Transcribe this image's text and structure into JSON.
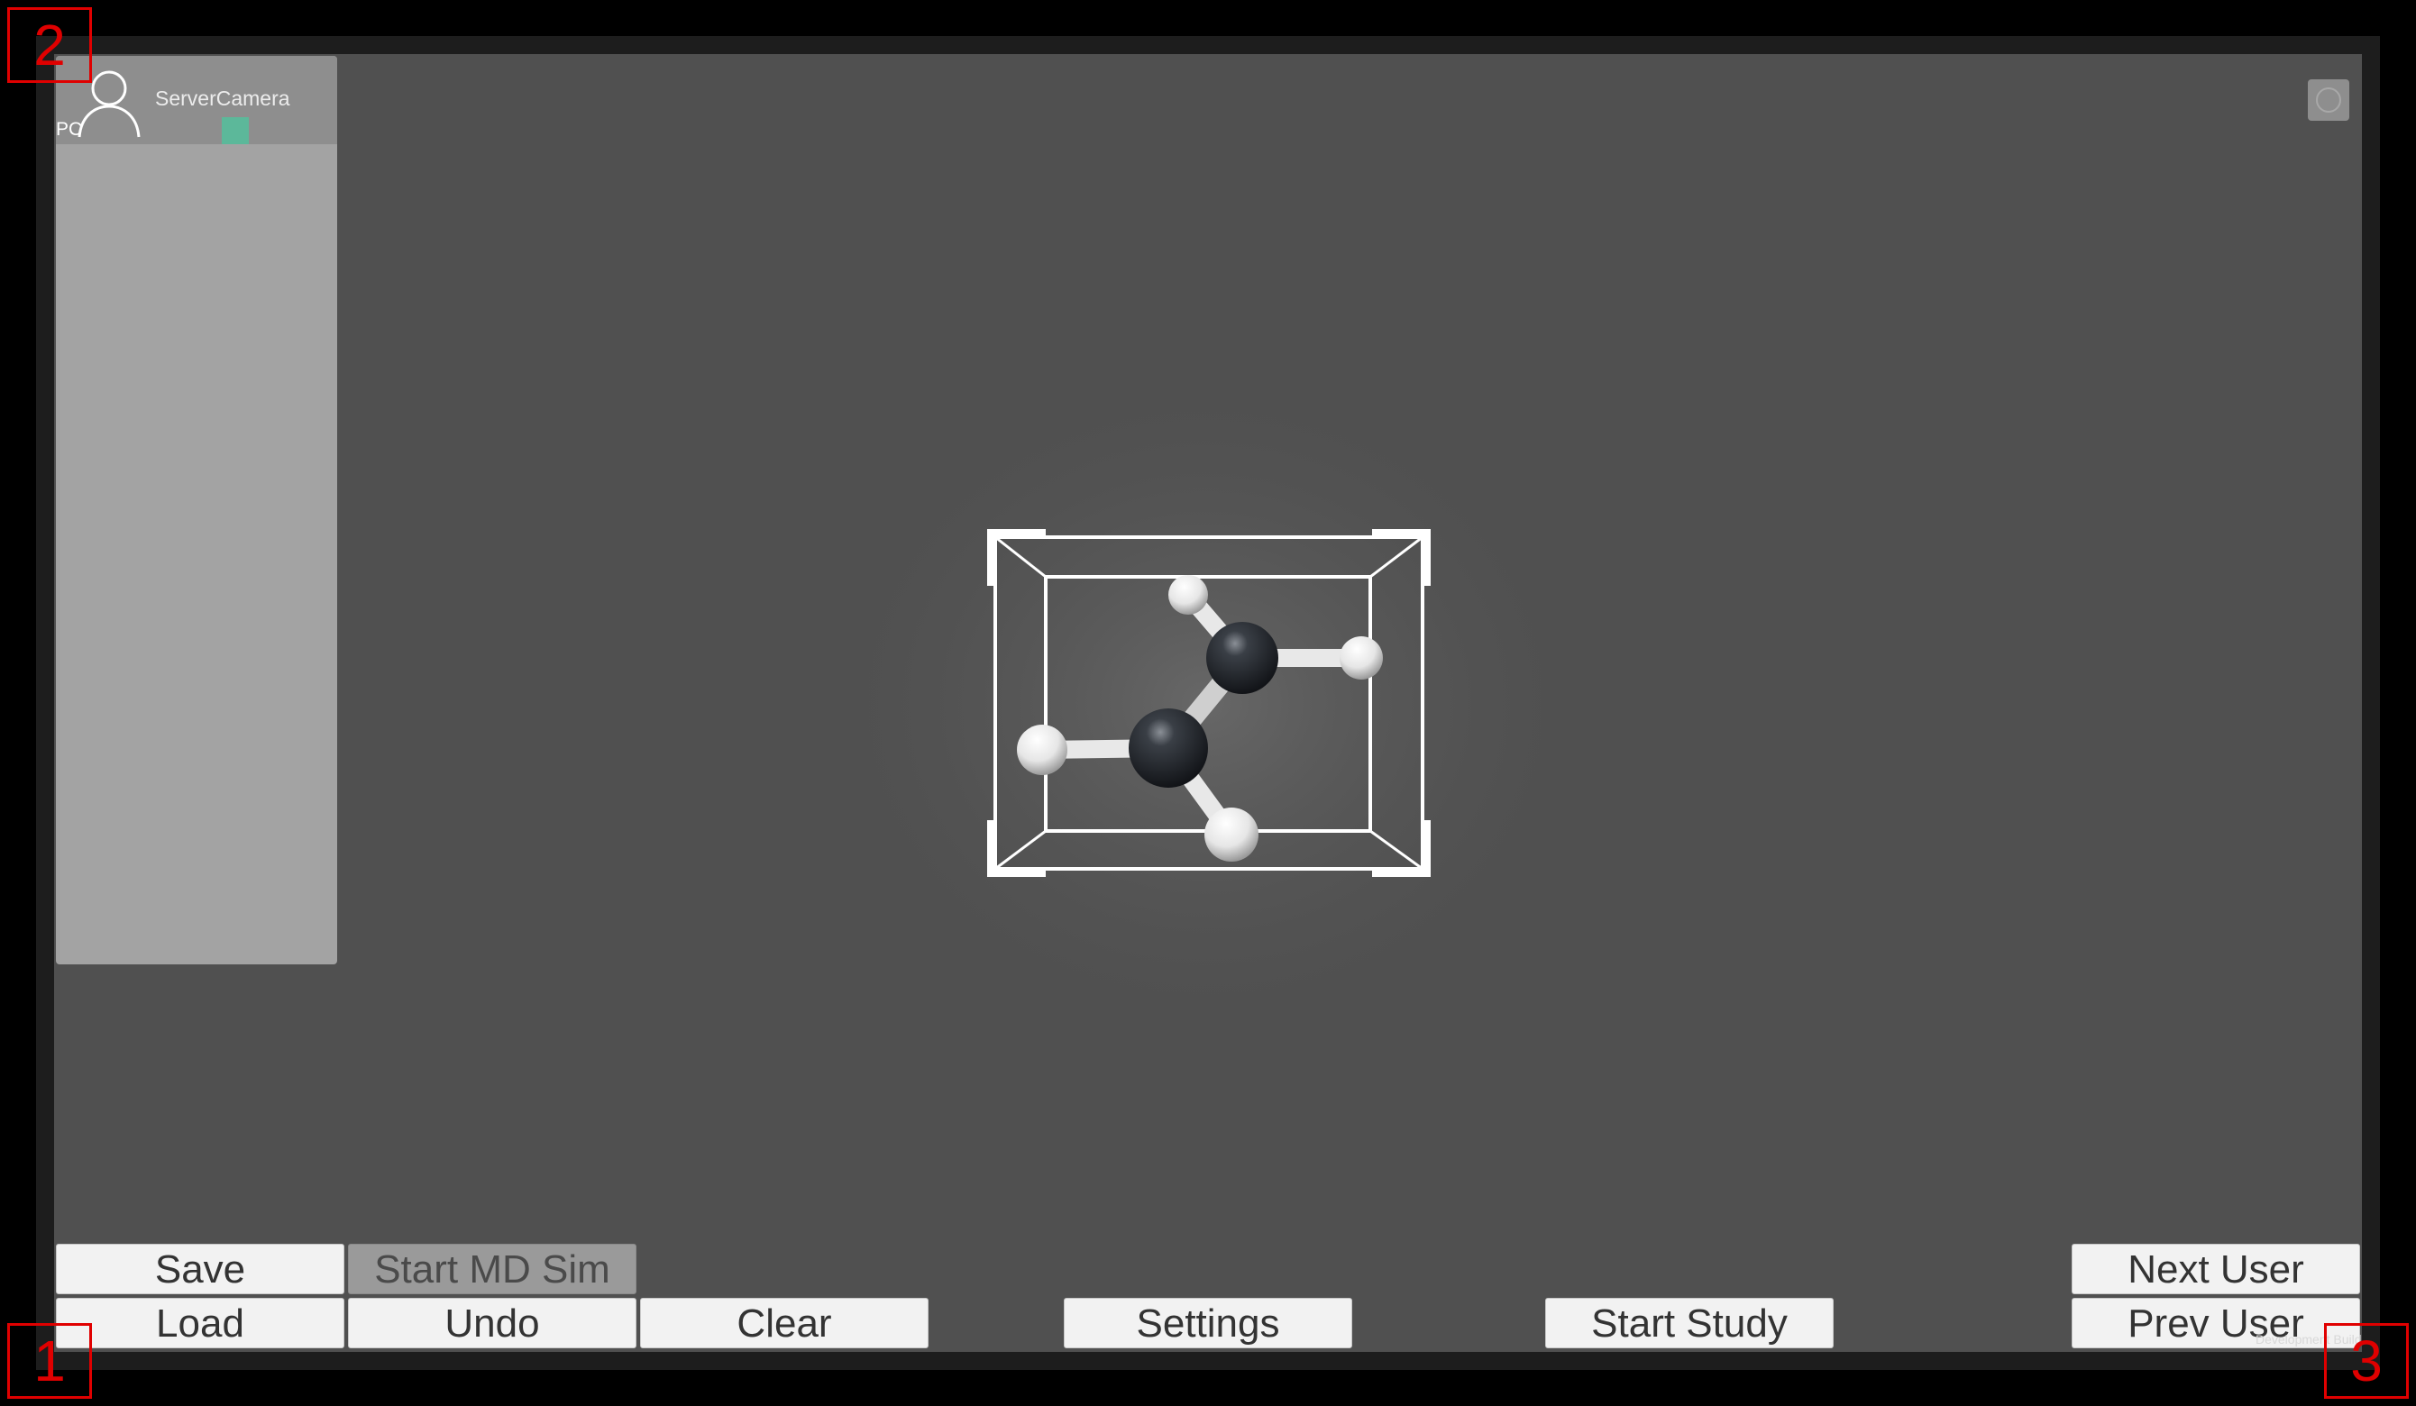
{
  "user_panel": {
    "user_tag": "PC",
    "user_name": "ServerCamera",
    "user_color": "#5cb89a"
  },
  "toolbar": {
    "save": "Save",
    "start_md_sim": "Start MD Sim",
    "load": "Load",
    "undo": "Undo",
    "clear": "Clear",
    "settings": "Settings",
    "start_study": "Start Study",
    "next_user": "Next User",
    "prev_user": "Prev User"
  },
  "overlay": {
    "dev_build": "Development Build"
  },
  "corner_labels": {
    "bottom_left": "1",
    "top_left": "2",
    "bottom_right": "3"
  },
  "molecule": {
    "atoms": [
      "C",
      "C",
      "H",
      "H",
      "H",
      "H"
    ]
  },
  "icons": {
    "info": "info-icon",
    "avatar": "user-avatar-icon"
  }
}
